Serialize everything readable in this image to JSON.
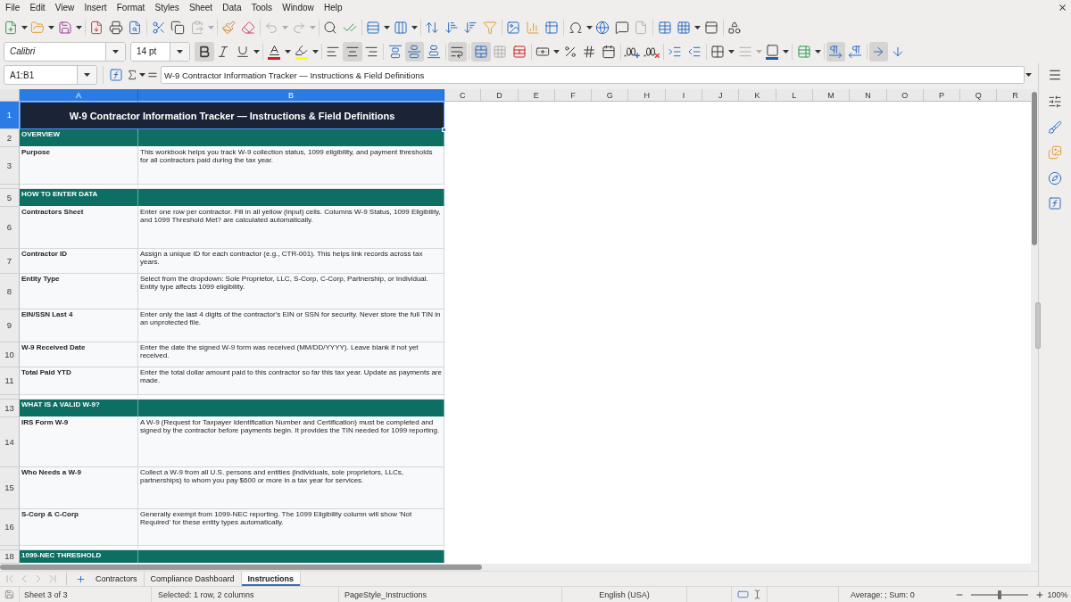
{
  "menu_bar": {
    "items": [
      "File",
      "Edit",
      "View",
      "Insert",
      "Format",
      "Styles",
      "Sheet",
      "Data",
      "Tools",
      "Window",
      "Help"
    ]
  },
  "standard_toolbar": {
    "paste": {
      "disabled": true
    },
    "undo": {
      "disabled": true
    },
    "redo": {
      "disabled": true
    },
    "headers_footers": {
      "disabled": true
    }
  },
  "formatting_toolbar": {
    "font_name": "Calibri",
    "font_size": "14 pt",
    "bold": true,
    "italic": false,
    "underline": false,
    "align_left": false,
    "align_center": true,
    "align_right": false,
    "align_top": false,
    "align_middle": true,
    "align_bottom": false,
    "wrap_text": true,
    "merge_and_center": true,
    "merge_cells": {
      "disabled": true
    },
    "border_style": {
      "disabled": true
    },
    "left_to_right": true,
    "right_to_left": false,
    "text_horizontal": true,
    "text_vertical": false
  },
  "formula_bar": {
    "name_box": "A1:B1",
    "content": "W-9 Contractor Information Tracker — Instructions & Field Definitions"
  },
  "sheet": {
    "columns": [
      {
        "label": "A",
        "selected": true
      },
      {
        "label": "B",
        "selected": true
      },
      {
        "label": "C",
        "selected": false
      },
      {
        "label": "D",
        "selected": false
      },
      {
        "label": "E",
        "selected": false
      },
      {
        "label": "F",
        "selected": false
      },
      {
        "label": "G",
        "selected": false
      },
      {
        "label": "H",
        "selected": false
      },
      {
        "label": "I",
        "selected": false
      },
      {
        "label": "J",
        "selected": false
      },
      {
        "label": "K",
        "selected": false
      },
      {
        "label": "L",
        "selected": false
      },
      {
        "label": "M",
        "selected": false
      },
      {
        "label": "N",
        "selected": false
      },
      {
        "label": "O",
        "selected": false
      },
      {
        "label": "P",
        "selected": false
      },
      {
        "label": "Q",
        "selected": false
      },
      {
        "label": "R",
        "selected": false
      }
    ],
    "rows": [
      {
        "number": "1",
        "kind": "title",
        "selected": true,
        "cells": [
          "W-9 Contractor Information Tracker — Instructions & Field Definitions"
        ]
      },
      {
        "number": "2",
        "kind": "section",
        "selected": false,
        "cells": [
          "OVERVIEW"
        ]
      },
      {
        "number": "3",
        "kind": "entry",
        "selected": false,
        "cells": [
          "Purpose",
          "This workbook helps you track W-9 collection status, 1099 eligibility, and payment thresholds for all contractors paid during the tax year."
        ]
      },
      {
        "kind": "spacer",
        "selected": false
      },
      {
        "number": "5",
        "kind": "section",
        "selected": false,
        "cells": [
          "HOW TO ENTER DATA"
        ]
      },
      {
        "number": "6",
        "kind": "entry",
        "selected": false,
        "cells": [
          "Contractors Sheet",
          "Enter one row per contractor. Fill in all yellow (input) cells. Columns W-9 Status, 1099 Eligibility, and 1099 Threshold Met? are calculated automatically."
        ]
      },
      {
        "number": "7",
        "kind": "entry",
        "selected": false,
        "cells": [
          "Contractor ID",
          "Assign a unique ID for each contractor (e.g., CTR-001). This helps link records across tax years."
        ]
      },
      {
        "number": "8",
        "kind": "entry",
        "selected": false,
        "cells": [
          "Entity Type",
          "Select from the dropdown: Sole Proprietor, LLC, S-Corp, C-Corp, Partnership, or Individual. Entity type affects 1099 eligibility."
        ]
      },
      {
        "number": "9",
        "kind": "entry",
        "selected": false,
        "cells": [
          "EIN/SSN Last 4",
          "Enter only the last 4 digits of the contractor's EIN or SSN for security. Never store the full TIN in an unprotected file."
        ]
      },
      {
        "number": "10",
        "kind": "entry",
        "selected": false,
        "cells": [
          "W-9 Received Date",
          "Enter the date the signed W-9 form was received (MM/DD/YYYY). Leave blank if not yet received."
        ]
      },
      {
        "number": "11",
        "kind": "entry",
        "selected": false,
        "cells": [
          "Total Paid YTD",
          "Enter the total dollar amount paid to this contractor so far this tax year. Update as payments are made."
        ]
      },
      {
        "kind": "spacer",
        "selected": false
      },
      {
        "number": "13",
        "kind": "section",
        "selected": false,
        "cells": [
          "WHAT IS A VALID W-9?"
        ]
      },
      {
        "number": "14",
        "kind": "entry",
        "selected": false,
        "cells": [
          "IRS Form W-9",
          "A W-9 (Request for Taxpayer Identification Number and Certification) must be completed and signed by the contractor before payments begin. It provides the TIN needed for 1099 reporting."
        ]
      },
      {
        "number": "15",
        "kind": "entry",
        "selected": false,
        "cells": [
          "Who Needs a W-9",
          "Collect a W-9 from all U.S. persons and entities (individuals, sole proprietors, LLCs, partnerships) to whom you pay $600 or more in a tax year for services."
        ]
      },
      {
        "number": "16",
        "kind": "entry",
        "selected": false,
        "cells": [
          "S-Corp & C-Corp",
          "Generally exempt from 1099-NEC reporting. The 1099 Eligibility column will show 'Not Required' for these entity types automatically."
        ]
      },
      {
        "kind": "spacer",
        "selected": false
      },
      {
        "number": "18",
        "kind": "section",
        "selected": false,
        "cells": [
          "1099-NEC THRESHOLD"
        ]
      }
    ]
  },
  "sheet_navigation": {
    "disabled": true
  },
  "sheet_tabs": [
    {
      "label": "Contractors",
      "selected": false
    },
    {
      "label": "Compliance Dashboard",
      "selected": false
    },
    {
      "label": "Instructions",
      "selected": true
    }
  ],
  "status_bar": {
    "sheet": "Sheet 3 of 3",
    "selection": "Selected: 1 row, 2 columns",
    "page_style": "PageStyle_Instructions",
    "language": "English (USA)",
    "summary": "Average: ; Sum: 0",
    "zoom": {
      "level": 0.5,
      "label": "100%"
    }
  }
}
